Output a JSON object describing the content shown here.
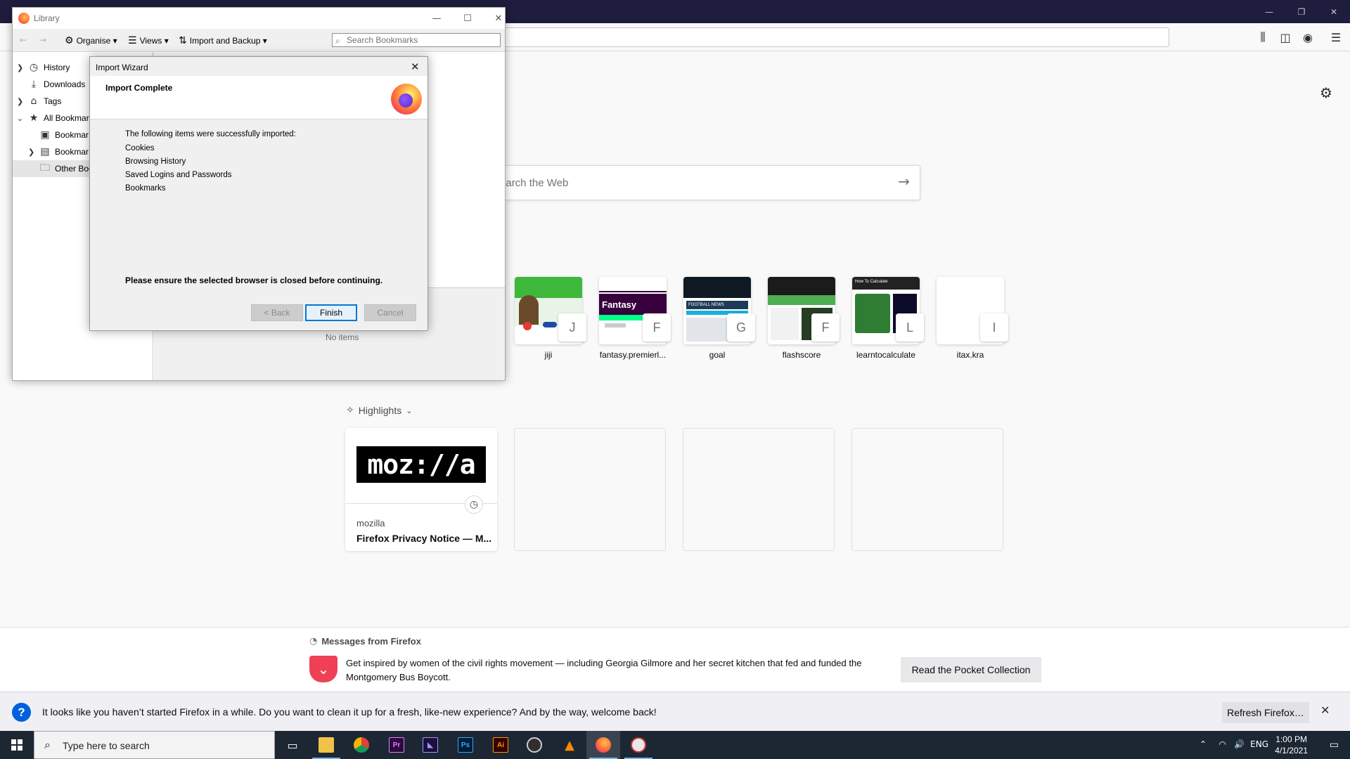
{
  "browser": {
    "content": {
      "search_placeholder": "Search the Web",
      "top_sites": [
        {
          "label": "jiji",
          "letter": "J"
        },
        {
          "label": "fantasy.premierl...",
          "letter": "F"
        },
        {
          "label": "goal",
          "letter": "G"
        },
        {
          "label": "flashscore",
          "letter": "F"
        },
        {
          "label": "learntocalculate",
          "letter": "L"
        },
        {
          "label": "itax.kra",
          "letter": "I"
        }
      ],
      "tile_text": {
        "fantasy": "Fantasy",
        "goal": "FOOTBALL NEWS",
        "learn": "How To Calculate"
      },
      "highlights": {
        "header": "Highlights",
        "card": {
          "logo": "moz://a",
          "site": "mozilla",
          "title": "Firefox Privacy Notice — M..."
        }
      }
    },
    "messages": {
      "header": "Messages from Firefox",
      "text": "Get inspired by women of the civil rights movement — including Georgia Gilmore and her secret kitchen that fed and funded the Montgomery Bus Boycott.",
      "button": "Read the Pocket Collection"
    },
    "notification": {
      "text": "It looks like you haven’t started Firefox in a while. Do you want to clean it up for a fresh, like-new experience? And by the way, welcome back!",
      "button": "Refresh Firefox…",
      "close": "✕"
    }
  },
  "library": {
    "title": "Library",
    "toolbar": {
      "organise": "Organise",
      "views": "Views",
      "import_backup": "Import and Backup",
      "search_placeholder": "Search Bookmarks"
    },
    "tree": [
      {
        "label": "History",
        "icon": "clock-icon"
      },
      {
        "label": "Downloads",
        "icon": "download-icon"
      },
      {
        "label": "Tags",
        "icon": "tag-icon"
      },
      {
        "label": "All Bookmar",
        "icon": "star-icon"
      },
      {
        "label": "Bookmar",
        "icon": "bookmark-toolbar-icon"
      },
      {
        "label": "Bookmar",
        "icon": "bookmark-menu-icon"
      },
      {
        "label": "Other Boo",
        "icon": "folder-icon"
      }
    ],
    "no_items": "No items"
  },
  "wizard": {
    "title": "Import Wizard",
    "heading": "Import Complete",
    "intro": "The following items were successfully imported:",
    "items": [
      "Cookies",
      "Browsing History",
      "Saved Logins and Passwords",
      "Bookmarks"
    ],
    "warning": "Please ensure the selected browser is closed before continuing.",
    "buttons": {
      "back": "< Back",
      "finish": "Finish",
      "cancel": "Cancel"
    }
  },
  "taskbar": {
    "search_placeholder": "Type here to search",
    "apps": [
      {
        "name": "Task View",
        "label": "▭"
      },
      {
        "name": "File Explorer",
        "label": ""
      },
      {
        "name": "Chrome",
        "label": ""
      },
      {
        "name": "Premiere Pro",
        "label": "Pr"
      },
      {
        "name": "Premiere Rush",
        "label": "◣"
      },
      {
        "name": "Photoshop",
        "label": "Ps"
      },
      {
        "name": "Illustrator",
        "label": "Ai"
      },
      {
        "name": "OBS",
        "label": ""
      },
      {
        "name": "VLC",
        "label": "▲"
      },
      {
        "name": "Firefox",
        "label": ""
      },
      {
        "name": "Migration",
        "label": ""
      }
    ],
    "tray": {
      "lang": "ENG",
      "time": "1:00 PM",
      "date": "4/1/2021"
    }
  },
  "colors": {
    "titlebar": "#1f1d3e",
    "pocket_red": "#ef4056",
    "notification_blue": "#0060df",
    "taskbar": "#1c2733"
  }
}
